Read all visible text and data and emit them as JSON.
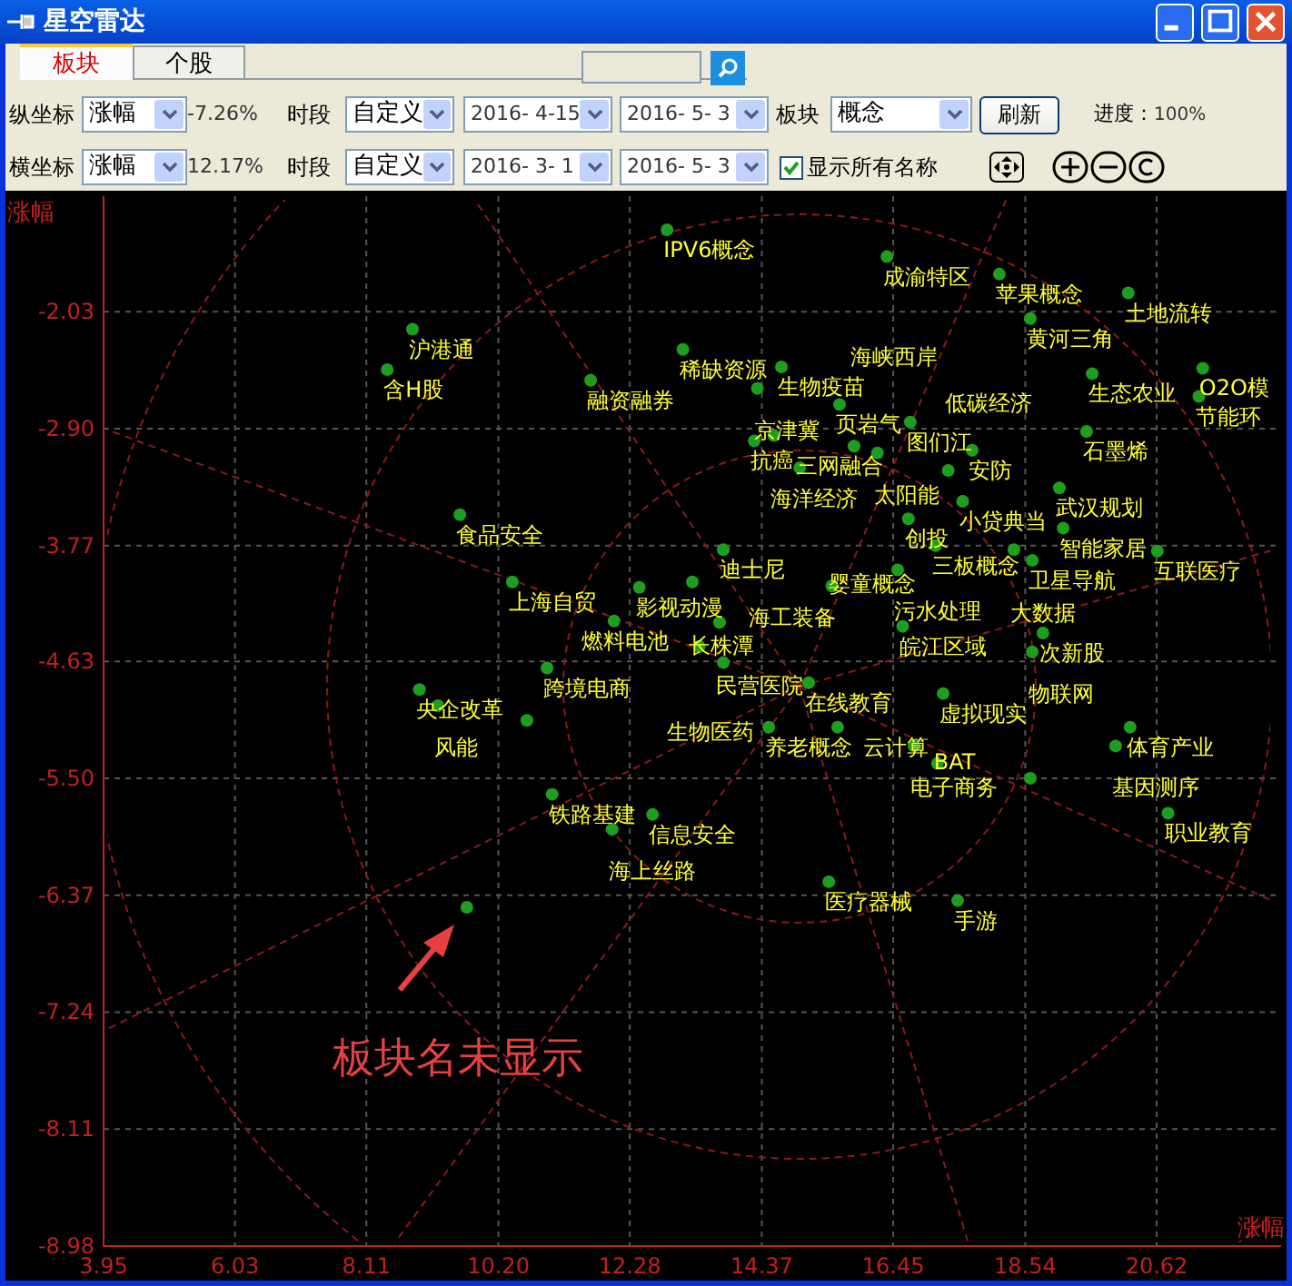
{
  "window": {
    "title": "星空雷达"
  },
  "tabs": [
    {
      "label": "板块",
      "selected": true
    },
    {
      "label": "个股",
      "selected": false
    }
  ],
  "axis_rows": [
    {
      "label": "纵坐标",
      "metric": "涨幅",
      "reading": "-7.26%",
      "period_label": "时段",
      "period": "自定义",
      "start": "2016- 4-15",
      "end": "2016- 5- 3"
    },
    {
      "label": "横坐标",
      "metric": "涨幅",
      "reading": "12.17%",
      "period_label": "时段",
      "period": "自定义",
      "start": "2016- 3- 1",
      "end": "2016- 5- 3"
    }
  ],
  "sector": {
    "label": "板块",
    "value": "概念"
  },
  "refresh_button": "刷新",
  "progress": {
    "label": "进度：",
    "value": "100%"
  },
  "show_all_names": {
    "label": "显示所有名称",
    "checked": true
  },
  "chart": {
    "chart_data": {
      "type": "scatter",
      "grid": true,
      "xlabel": "涨幅",
      "ylabel": "涨幅",
      "xlim": [
        3.95,
        22.59
      ],
      "ylim": [
        -8.98,
        -1.17
      ],
      "xticks": [
        {
          "value": 3.95,
          "label": "3.95"
        },
        {
          "value": 6.03,
          "label": "6.03"
        },
        {
          "value": 8.11,
          "label": "8.11"
        },
        {
          "value": 10.2,
          "label": "10.20"
        },
        {
          "value": 12.28,
          "label": "12.28"
        },
        {
          "value": 14.37,
          "label": "14.37"
        },
        {
          "value": 16.45,
          "label": "16.45"
        },
        {
          "value": 18.54,
          "label": "18.54"
        },
        {
          "value": 20.62,
          "label": "20.62"
        }
      ],
      "yticks": [
        {
          "value": -2.03,
          "label": "-2.03"
        },
        {
          "value": -2.9,
          "label": "-2.90"
        },
        {
          "value": -3.77,
          "label": "-3.77"
        },
        {
          "value": -4.63,
          "label": "-4.63"
        },
        {
          "value": -5.5,
          "label": "-5.50"
        },
        {
          "value": -6.37,
          "label": "-6.37"
        },
        {
          "value": -7.24,
          "label": "-7.24"
        },
        {
          "value": -8.11,
          "label": "-8.11"
        },
        {
          "value": -8.98,
          "label": "-8.98"
        }
      ],
      "x": [
        12.87,
        8.84,
        8.44,
        11.66,
        13.12,
        14.68,
        14.3,
        14.25,
        14.56,
        14.97,
        9.59,
        13.76,
        10.42,
        12.43,
        13.27,
        12.03,
        13.7,
        16.35,
        18.13,
        20.17,
        18.62,
        19.6,
        21.35,
        21.29,
        19.51,
        17.7,
        17.55,
        19.08,
        16.69,
        19.14,
        17.12,
        18.65,
        20.63,
        16.52,
        15.48,
        16.6,
        18.82,
        18.65,
        17.24,
        15.11,
        10.97,
        8.95,
        9.24,
        14.48,
        15.57,
        16.78,
        17.15,
        20.2,
        19.97,
        20.8,
        11.05,
        12.64,
        12.0,
        15.43,
        17.47,
        13.38,
        13.76,
        16.2,
        15.6,
        16.72,
        15.83,
        17.32,
        18.36,
        10.65,
        18.62,
        9.7
      ],
      "series": [
        {
          "color": "#1e9e1e",
          "values": [
            -1.42,
            -2.16,
            -2.46,
            -2.54,
            -2.31,
            -2.44,
            -2.6,
            -2.99,
            -2.95,
            -3.19,
            -3.54,
            -3.8,
            -4.04,
            -4.08,
            -4.04,
            -4.33,
            -4.34,
            -1.62,
            -1.75,
            -1.89,
            -2.08,
            -2.49,
            -2.45,
            -2.66,
            -2.92,
            -3.06,
            -3.44,
            -3.34,
            -3.57,
            -3.64,
            -3.77,
            -3.88,
            -3.81,
            -3.95,
            -4.07,
            -4.37,
            -4.42,
            -4.56,
            -4.87,
            -4.79,
            -4.68,
            -4.84,
            -4.96,
            -5.12,
            -5.12,
            -5.26,
            -5.39,
            -5.12,
            -5.26,
            -5.76,
            -5.62,
            -5.77,
            -5.88,
            -6.27,
            -6.41,
            -4.52,
            -4.64,
            -3.08,
            -2.72,
            -2.85,
            -3.03,
            -3.21,
            -3.8,
            -5.07,
            -5.5,
            -6.46
          ]
        }
      ],
      "annotations": [
        "IPV6概念",
        "沪港通",
        "含H股",
        "融资融券",
        "稀缺资源",
        "生物疫苗",
        "京津冀",
        "抗癌",
        "海洋经济",
        "三网融合",
        "食品安全",
        "迪士尼",
        "上海自贸",
        "影视动漫",
        "长株潭",
        "燃料电池",
        "民营医院",
        "成渝特区",
        "苹果概念",
        "土地流转",
        "黄河三角",
        "生态农业",
        "O2O模",
        "节能环",
        "石墨烯",
        "安防",
        "小贷典当",
        "武汉规划",
        "创投",
        "智能家居",
        "三板概念",
        "卫星导航",
        "互联医疗",
        "污水处理",
        "婴童概念",
        "皖江区域",
        "次新股",
        "物联网",
        "虚拟现实",
        "在线教育",
        "跨境电商",
        "央企改革",
        "风能",
        "养老概念",
        "云计算",
        "电子商务",
        "BAT",
        "体育产业",
        "基因测序",
        "职业教育",
        "铁路基建",
        "信息安全",
        "海上丝路",
        "医疗器械",
        "手游",
        "生物医药",
        "海工装备",
        "太阳能",
        "页岩气",
        "图们江",
        "海峡西岸",
        "低碳经济",
        "大数据"
      ]
    },
    "callout": {
      "text": "板块名未显示"
    }
  }
}
